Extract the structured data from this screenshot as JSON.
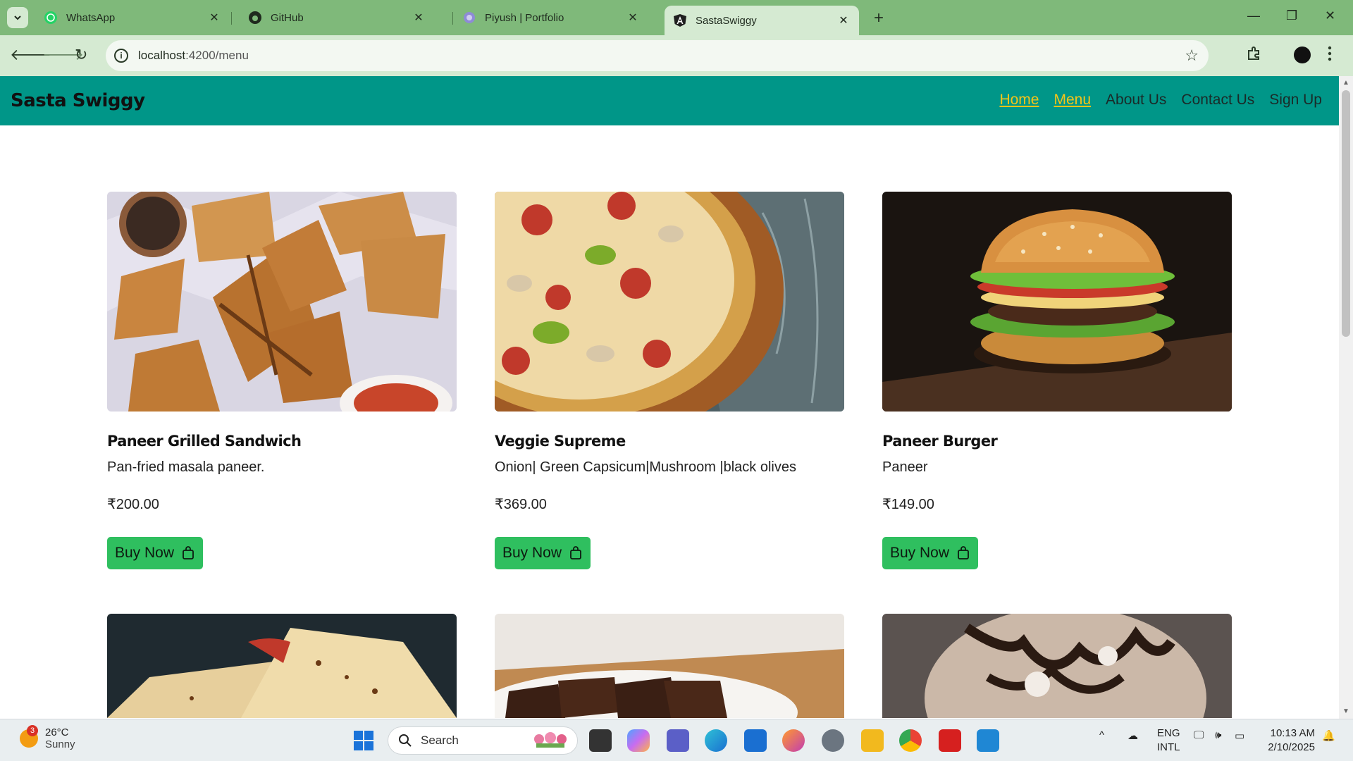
{
  "browser": {
    "tabs": [
      {
        "title": "WhatsApp",
        "icon": "whatsapp-icon",
        "active": false
      },
      {
        "title": "GitHub",
        "icon": "github-icon",
        "active": false
      },
      {
        "title": "Piyush | Portfolio",
        "icon": "portfolio-icon",
        "active": false
      },
      {
        "title": "SastaSwiggy",
        "icon": "angular-icon",
        "active": true
      }
    ],
    "url_host": "localhost",
    "url_path": ":4200/menu"
  },
  "app": {
    "brand": "Sasta Swiggy",
    "nav": [
      "Home",
      "Menu",
      "About Us",
      "Contact Us",
      "Sign Up"
    ],
    "buy_label": "Buy Now",
    "items": [
      {
        "name": "Paneer Grilled Sandwich",
        "desc": "Pan-fried masala paneer.",
        "price": "₹200.00"
      },
      {
        "name": "Veggie Supreme",
        "desc": "Onion| Green Capsicum|Mushroom |black olives",
        "price": "₹369.00"
      },
      {
        "name": "Paneer Burger",
        "desc": "Paneer",
        "price": "₹149.00"
      }
    ]
  },
  "taskbar": {
    "weather_temp": "26°C",
    "weather_desc": "Sunny",
    "weather_badge": "3",
    "search_label": "Search",
    "lang1": "ENG",
    "lang2": "INTL",
    "time": "10:13 AM",
    "date": "2/10/2025"
  },
  "colors": {
    "tabbar": "#7fb97a",
    "app_nav": "#009688",
    "buy_button": "#2fbf5f",
    "nav_highlight": "#f5c518"
  }
}
